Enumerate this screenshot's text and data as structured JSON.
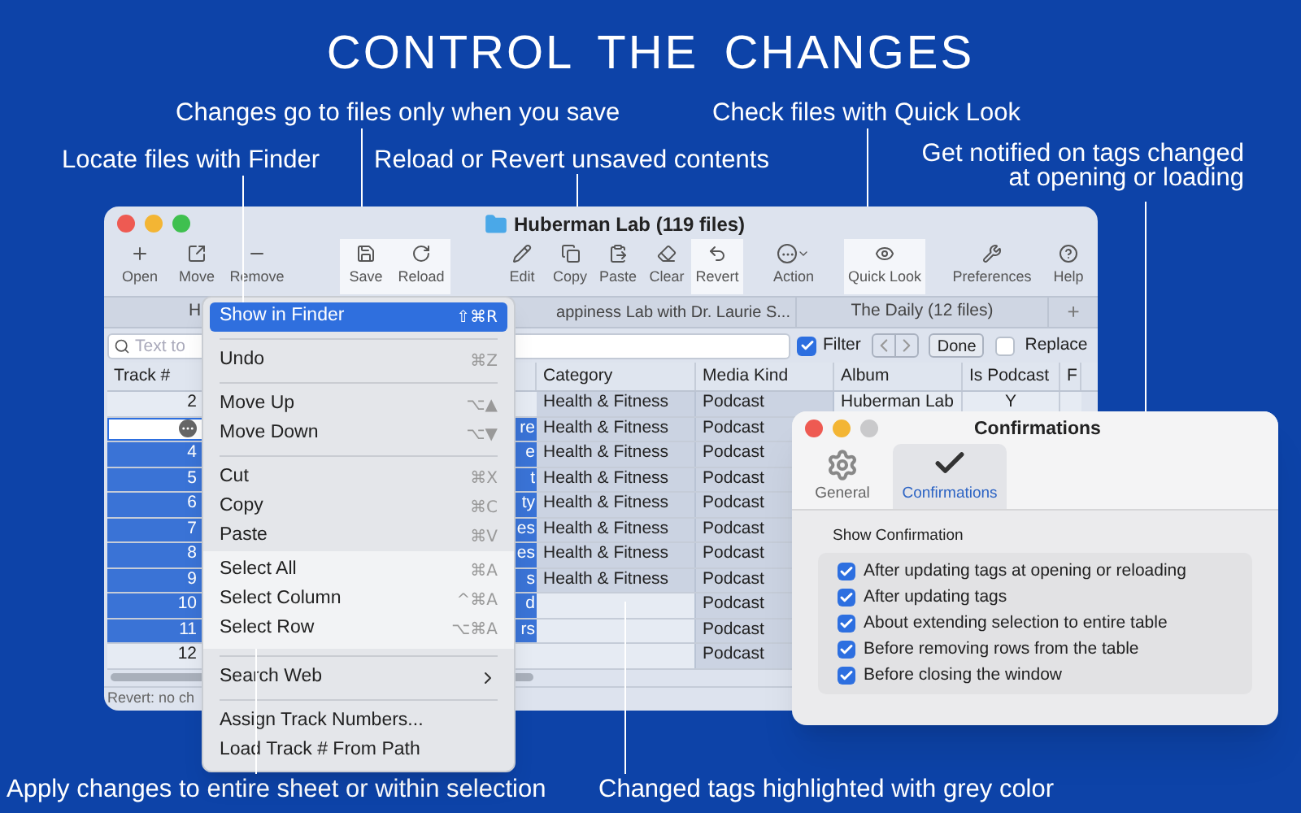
{
  "headline": "CONTROL THE CHANGES",
  "callouts": [
    {
      "text": "Changes go to files only when you save"
    },
    {
      "text": "Check files with Quick Look"
    },
    {
      "text": "Locate files with Finder"
    },
    {
      "text": "Reload or Revert unsaved contents"
    },
    {
      "text": "Get notified on tags changed at opening or loading"
    },
    {
      "text": "Apply changes to entire sheet or within selection"
    },
    {
      "text": "Changed tags highlighted with grey color"
    }
  ],
  "main_window": {
    "title": "Huberman Lab (119 files)",
    "toolbar": [
      {
        "label": "Open",
        "highlighted": false
      },
      {
        "label": "Move",
        "highlighted": false
      },
      {
        "label": "Remove",
        "highlighted": false
      },
      {
        "label": "Save",
        "highlighted": true
      },
      {
        "label": "Reload",
        "highlighted": true
      },
      {
        "label": "Edit",
        "highlighted": false
      },
      {
        "label": "Copy",
        "highlighted": false
      },
      {
        "label": "Paste",
        "highlighted": false
      },
      {
        "label": "Clear",
        "highlighted": false
      },
      {
        "label": "Revert",
        "highlighted": true
      },
      {
        "label": "Action",
        "highlighted": false
      },
      {
        "label": "Quick Look",
        "highlighted": true
      },
      {
        "label": "Preferences",
        "highlighted": false
      },
      {
        "label": "Help",
        "highlighted": false
      }
    ],
    "tabs": [
      {
        "label": "H"
      },
      {
        "label": "appiness Lab with Dr. Laurie S..."
      },
      {
        "label": "The Daily (12 files)"
      }
    ],
    "add_tab": "+",
    "search": {
      "placeholder": "Text to"
    },
    "filter": {
      "label": "Filter",
      "checked": true
    },
    "done": "Done",
    "replace": {
      "label": "Replace",
      "checked": false
    },
    "table": {
      "columns": [
        "Track #",
        "Category",
        "Media Kind",
        "Album",
        "Is Podcast",
        "F"
      ],
      "rows": [
        {
          "track": "2",
          "column_2": "",
          "category": "Health & Fitness",
          "media_kind": "Podcast",
          "album": "Huberman Lab",
          "is_podcast": "Y",
          "selected": false,
          "editing": false,
          "changed": true
        },
        {
          "track": "",
          "column_2": "re",
          "category": "Health & Fitness",
          "media_kind": "Podcast",
          "selected": true,
          "editing": true,
          "changed": true
        },
        {
          "track": "4",
          "column_2": "e",
          "category": "Health & Fitness",
          "media_kind": "Podcast",
          "selected": true,
          "editing": false,
          "changed": true
        },
        {
          "track": "5",
          "column_2": "t",
          "category": "Health & Fitness",
          "media_kind": "Podcast",
          "selected": true,
          "editing": false,
          "changed": true
        },
        {
          "track": "6",
          "column_2": "ty",
          "category": "Health & Fitness",
          "media_kind": "Podcast",
          "selected": true,
          "editing": false,
          "changed": true
        },
        {
          "track": "7",
          "column_2": "es",
          "category": "Health & Fitness",
          "media_kind": "Podcast",
          "selected": true,
          "editing": false,
          "changed": true
        },
        {
          "track": "8",
          "column_2": "es",
          "category": "Health & Fitness",
          "media_kind": "Podcast",
          "selected": true,
          "editing": false,
          "changed": true
        },
        {
          "track": "9",
          "column_2": "s",
          "category": "Health & Fitness",
          "media_kind": "Podcast",
          "selected": true,
          "editing": false,
          "changed": true
        },
        {
          "track": "10",
          "column_2": "d",
          "category": "",
          "media_kind": "Podcast",
          "selected": true,
          "editing": false,
          "changed": true
        },
        {
          "track": "11",
          "column_2": "rs",
          "category": "",
          "media_kind": "Podcast",
          "selected": true,
          "editing": false,
          "changed": true
        },
        {
          "track": "12",
          "column_2": "",
          "category": "",
          "media_kind": "Podcast",
          "selected": false,
          "editing": false,
          "changed": true
        }
      ]
    },
    "status": "Revert: no ch"
  },
  "context_menu": {
    "groups": [
      {
        "emphasized": false,
        "items": [
          {
            "label": "Show in Finder",
            "shortcut": "⇧⌘R",
            "selected": true
          }
        ]
      },
      {
        "emphasized": false,
        "items": [
          {
            "label": "Undo",
            "shortcut": "⌘Z",
            "selected": false
          }
        ]
      },
      {
        "emphasized": false,
        "items": [
          {
            "label": "Move Up",
            "shortcut": "⌥▲",
            "selected": false
          },
          {
            "label": "Move Down",
            "shortcut": "⌥▼",
            "selected": false
          }
        ]
      },
      {
        "emphasized": false,
        "items": [
          {
            "label": "Cut",
            "shortcut": "⌘X",
            "selected": false
          },
          {
            "label": "Copy",
            "shortcut": "⌘C",
            "selected": false
          },
          {
            "label": "Paste",
            "shortcut": "⌘V",
            "selected": false
          }
        ]
      },
      {
        "emphasized": true,
        "items": [
          {
            "label": "Select All",
            "shortcut": "⌘A",
            "selected": false
          },
          {
            "label": "Select Column",
            "shortcut": "^⌘A",
            "selected": false
          },
          {
            "label": "Select Row",
            "shortcut": "⌥⌘A",
            "selected": false
          }
        ]
      },
      {
        "emphasized": false,
        "items": [
          {
            "label": "Search Web",
            "submenu": true,
            "selected": false
          }
        ]
      },
      {
        "emphasized": false,
        "items": [
          {
            "label": "Assign Track Numbers...",
            "selected": false
          },
          {
            "label": "Load Track # From Path",
            "selected": false
          }
        ]
      }
    ]
  },
  "dialog": {
    "title": "Confirmations",
    "tabs": [
      {
        "label": "General",
        "selected": false
      },
      {
        "label": "Confirmations",
        "selected": true
      }
    ],
    "group_title": "Show Confirmation",
    "options": [
      {
        "label": "After updating tags at opening or reloading",
        "checked": true
      },
      {
        "label": "After updating tags",
        "checked": true
      },
      {
        "label": "About extending selection to entire table",
        "checked": true
      },
      {
        "label": "Before removing rows from the table",
        "checked": true
      },
      {
        "label": "Before closing the window",
        "checked": true
      }
    ]
  }
}
